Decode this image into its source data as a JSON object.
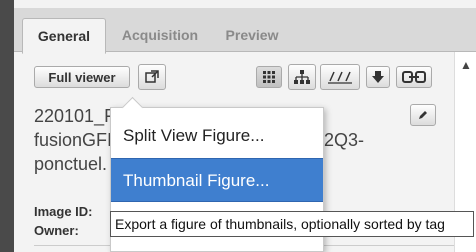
{
  "tabs": [
    {
      "label": "General",
      "active": true
    },
    {
      "label": "Acquisition",
      "active": false
    },
    {
      "label": "Preview",
      "active": false
    }
  ],
  "toolbar": {
    "full_viewer_label": "Full viewer",
    "icons": [
      "open-external-icon",
      "grid-icon",
      "hierarchy-icon",
      "axis-icon",
      "download-icon",
      "link-icon"
    ]
  },
  "image": {
    "title_line1": "220101_F",
    "title_line2": "fusionGFI",
    "title_line3": "ponctuel.",
    "title_right": "2Q3-"
  },
  "meta": {
    "image_id_label": "Image ID:",
    "owner_label": "Owner:"
  },
  "menu": {
    "items": [
      {
        "label": "Split View Figure...",
        "highlighted": false
      },
      {
        "label": "Thumbnail Figure...",
        "highlighted": true
      }
    ]
  },
  "tooltip": "Export a figure of thumbnails, optionally sorted by tag",
  "colors": {
    "highlight": "#3f7fcf",
    "panel_bg": "#f3f3f3"
  }
}
